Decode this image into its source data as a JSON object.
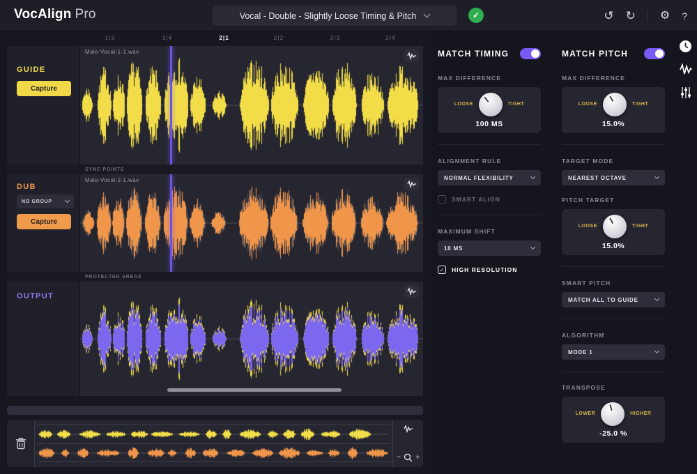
{
  "app": {
    "brand_bold": "VocAlign",
    "brand_light": "Pro",
    "preset": "Vocal - Double - Slightly Loose Timing & Pitch",
    "help": "?"
  },
  "icons": {
    "undo": "↺",
    "redo": "↻",
    "gear": "⚙",
    "check": "✓",
    "minus": "−",
    "plus": "+"
  },
  "timeline": {
    "ticks": [
      "1|3",
      "1|4",
      "2|1",
      "2|2",
      "2|3",
      "2|4"
    ]
  },
  "tracks": {
    "guide": {
      "name": "GUIDE",
      "capture": "Capture",
      "file": "Male-Vocal-1-1.wav"
    },
    "sync_points_label": "SYNC POINTS",
    "dub": {
      "name": "DUB",
      "group": "NO GROUP",
      "capture": "Capture",
      "file": "Male-Vocal-2-1.wav"
    },
    "protected_areas_label": "PROTECTED AREAS",
    "output": {
      "name": "OUTPUT"
    }
  },
  "timing": {
    "title": "MATCH TIMING",
    "max_difference_label": "MAX DIFFERENCE",
    "knob_left": "LOOSE",
    "knob_right": "TIGHT",
    "knob_value": "100 MS",
    "alignment_rule_label": "ALIGNMENT RULE",
    "alignment_rule_value": "NORMAL FLEXIBILITY",
    "smart_align_label": "SMART ALIGN",
    "maximum_shift_label": "MAXIMUM SHIFT",
    "maximum_shift_value": "10 MS",
    "high_resolution_label": "HIGH RESOLUTION"
  },
  "pitch": {
    "title": "MATCH PITCH",
    "max_difference_label": "MAX DIFFERENCE",
    "max_knob_left": "LOOSE",
    "max_knob_right": "TIGHT",
    "max_knob_value": "15.0%",
    "target_mode_label": "TARGET MODE",
    "target_mode_value": "NEAREST OCTAVE",
    "pitch_target_label": "PITCH TARGET",
    "pt_knob_left": "LOOSE",
    "pt_knob_right": "TIGHT",
    "pt_knob_value": "15.0%",
    "smart_pitch_label": "SMART PITCH",
    "smart_pitch_value": "MATCH ALL TO GUIDE",
    "algorithm_label": "ALGORITHM",
    "algorithm_value": "MODE 1",
    "transpose_label": "TRANSPOSE",
    "tr_knob_left": "LOWER",
    "tr_knob_right": "HIGHER",
    "tr_knob_value": "-25.0 %"
  },
  "colors": {
    "accent": "#7a5af5",
    "guide_yellow": "#f2dd49",
    "dub_orange": "#f0964b",
    "output_purple": "#7b68ee",
    "success_green": "#2fae52",
    "ghost": "rgba(205,205,215,0.22)"
  }
}
